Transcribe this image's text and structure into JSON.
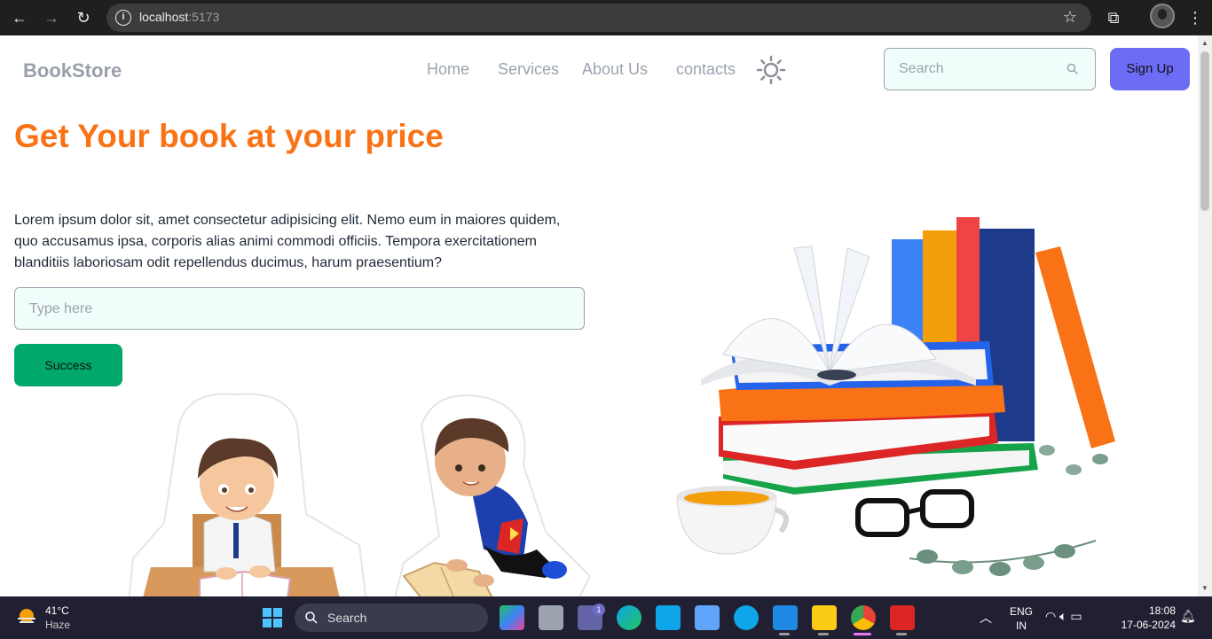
{
  "browser": {
    "url_host": "localhost",
    "url_port": ":5173"
  },
  "header": {
    "brand": "BookStore",
    "nav": [
      "Home",
      "Services",
      "About Us",
      "contacts"
    ],
    "search_placeholder": "Search",
    "signup_label": "Sign Up"
  },
  "hero": {
    "title": "Get Your book at your price",
    "body": "Lorem ipsum dolor sit, amet consectetur adipisicing elit. Nemo eum in maiores quidem, quo accusamus ipsa, corporis alias animi commodi officiis. Tempora exercitationem blanditiis laboriosam odit repellendus ducimus, harum praesentium?",
    "input_placeholder": "Type here",
    "button_label": "Success"
  },
  "taskbar": {
    "temperature": "41°C",
    "weather": "Haze",
    "search_label": "Search",
    "lang_line1": "ENG",
    "lang_line2": "IN",
    "time": "18:08",
    "date": "17-06-2024",
    "teams_badge": "1"
  },
  "colors": {
    "accent_orange": "#f97316",
    "signup_bg": "#6c6cf5",
    "success_bg": "#00a86b"
  }
}
